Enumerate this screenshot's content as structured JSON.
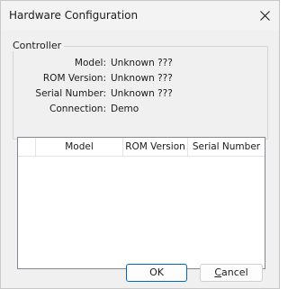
{
  "window": {
    "title": "Hardware Configuration",
    "close_icon": "close-icon"
  },
  "controller": {
    "group_label": "Controller",
    "fields": [
      {
        "label": "Model:",
        "value": "Unknown ???"
      },
      {
        "label": "ROM Version:",
        "value": "Unknown ???"
      },
      {
        "label": "Serial Number:",
        "value": "Unknown ???"
      },
      {
        "label": "Connection:",
        "value": "Demo"
      }
    ]
  },
  "listview": {
    "columns": [
      "",
      "Model",
      "ROM Version",
      "Serial Number"
    ],
    "rows": []
  },
  "buttons": {
    "ok_label": "OK",
    "cancel_accel": "C",
    "cancel_rest": "ancel"
  }
}
